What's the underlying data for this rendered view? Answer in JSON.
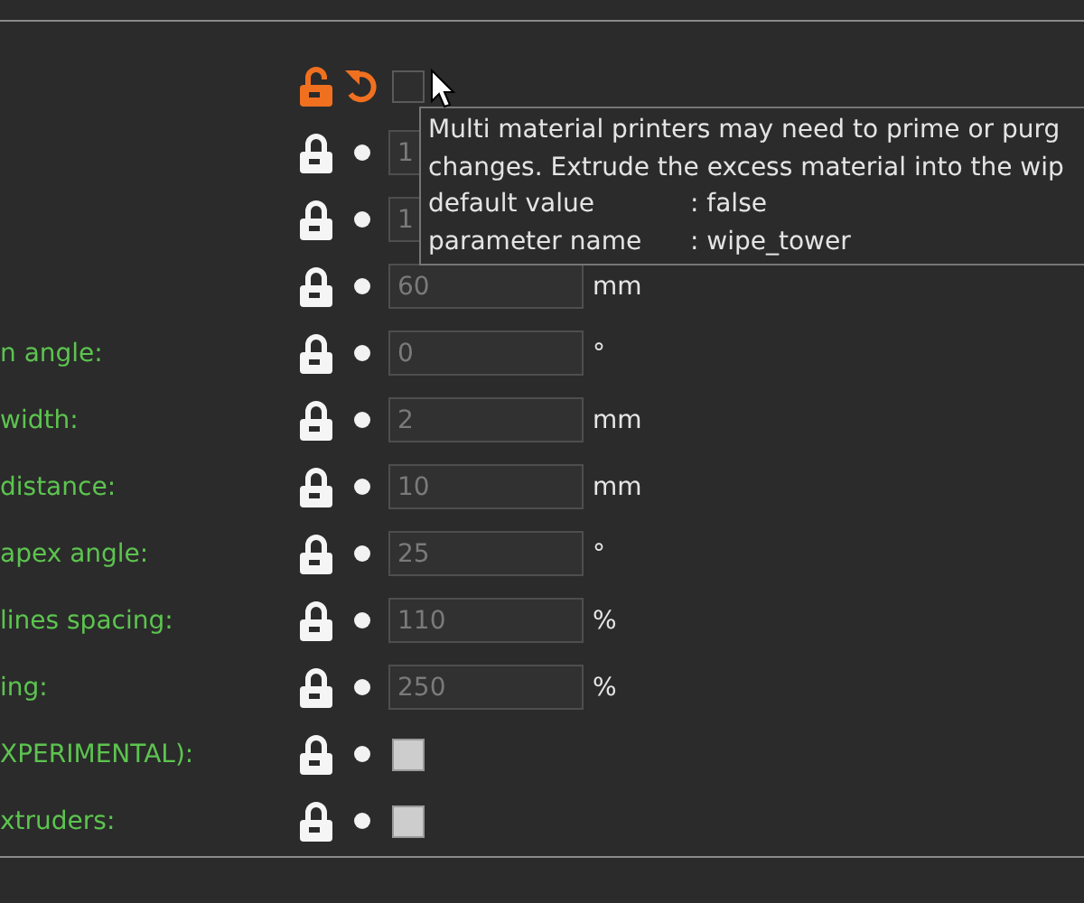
{
  "rows": [
    {
      "kind": "checkbox",
      "locked": false,
      "checked": false,
      "disabled": false
    },
    {
      "kind": "number",
      "locked": true,
      "value": "1"
    },
    {
      "kind": "number",
      "locked": true,
      "value": "1"
    },
    {
      "kind": "number",
      "locked": true,
      "value": "60",
      "unit": "mm"
    },
    {
      "kind": "number",
      "locked": true,
      "label": "n angle:",
      "value": "0",
      "unit": "°"
    },
    {
      "kind": "number",
      "locked": true,
      "label": "width:",
      "value": "2",
      "unit": "mm"
    },
    {
      "kind": "number",
      "locked": true,
      "label": "distance:",
      "value": "10",
      "unit": "mm"
    },
    {
      "kind": "number",
      "locked": true,
      "label": "apex angle:",
      "value": "25",
      "unit": "°"
    },
    {
      "kind": "number",
      "locked": true,
      "label": "lines spacing:",
      "value": "110",
      "unit": "%"
    },
    {
      "kind": "number",
      "locked": true,
      "label": "ing:",
      "value": "250",
      "unit": "%"
    },
    {
      "kind": "checkbox",
      "locked": true,
      "label": "XPERIMENTAL):",
      "checked": false,
      "disabled": true
    },
    {
      "kind": "checkbox",
      "locked": true,
      "label": "xtruders:",
      "checked": false,
      "disabled": true
    }
  ],
  "tooltip": {
    "lines": [
      "Multi material printers may need to prime or purg",
      "changes. Extrude the excess material into the wip"
    ],
    "details": [
      {
        "key": "default value",
        "value": ": false"
      },
      {
        "key": "parameter name",
        "value": ": wipe_tower"
      }
    ]
  }
}
